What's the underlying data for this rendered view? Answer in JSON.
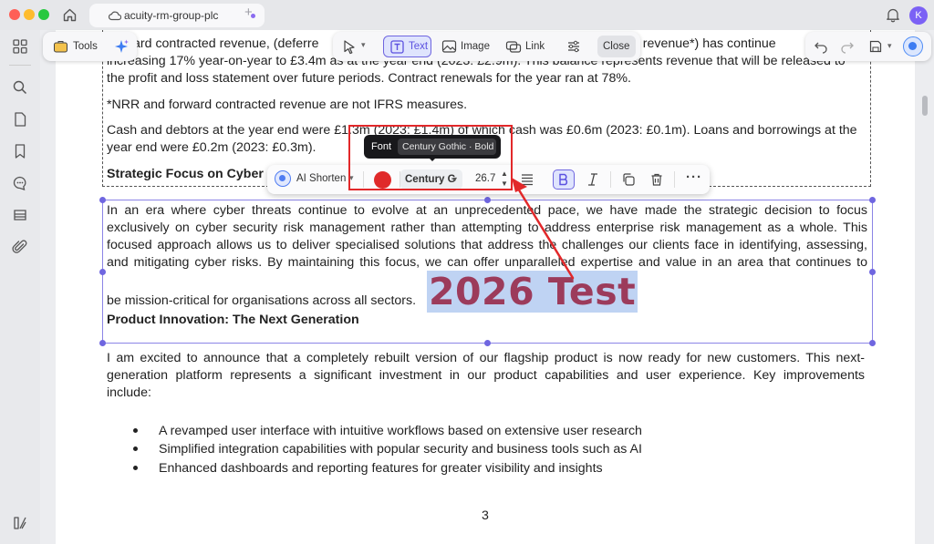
{
  "window": {
    "tab_title": "acuity-rm-group-plc",
    "new_tab": "+",
    "avatar_initial": "K"
  },
  "toolbar": {
    "tools_label": "Tools",
    "text_label": "Text",
    "image_label": "Image",
    "link_label": "Link",
    "close_label": "Close"
  },
  "float_bar": {
    "ai_label": "AI Shorten",
    "font_name": "Century G",
    "font_size": "26.7",
    "color": "#e02a2a"
  },
  "tooltip": {
    "label": "Font",
    "value": "Century Gothic · Bold"
  },
  "document": {
    "p1_line1_left": "ard contracted revenue, (deferre",
    "p1_line1_right": "cted revenue*) has continue",
    "p1_line2": "increasing 17% year-on-year to £3.4m as at the year end (2023: £2.9m). This balance represents revenue that will be released to",
    "p1_line3": "the profit and loss statement over future periods. Contract renewals for the year ran at 78%.",
    "p2": "*NRR and forward contracted revenue are not IFRS measures.",
    "p3_line1": "Cash and debtors at the year end were £1.3m (2023: £1.4m) of which cash was £0.6m (2023: £0.1m). Loans and borrowings at the",
    "p3_line2": "year end were £0.2m (2023: £0.3m).",
    "heading1": "Strategic Focus on Cyber Se",
    "p4_line1": "In an era where cyber threats continue to evolve at an unprecedented pace, we have made the strategic decision to focus",
    "p4_line2": "exclusively on cyber security risk management rather than attempting to address enterprise risk management as a whole. This",
    "p4_line3": "focused approach allows us to deliver specialised solutions that address the challenges our clients face in identifying, assessing,",
    "p4_line4": "and mitigating cyber risks. By maintaining this focus, we can offer unparalleled expertise and value in an area that continues to",
    "p4_line5": "be mission-critical for organisations across all sectors.",
    "inserted_text": "2026 Test",
    "heading2": "Product Innovation: The Next Generation",
    "p5_line1": "I am excited to announce that a completely rebuilt version of our flagship product is now ready for new customers. This next-",
    "p5_line2": "generation platform represents a significant investment in our product capabilities and user experience. Key improvements",
    "p5_line3": "include:",
    "bullets": [
      "A revamped user interface with intuitive workflows based on extensive user research",
      "Simplified integration capabilities with popular security and business tools such as AI",
      "Enhanced dashboards and reporting features for greater visibility and insights"
    ],
    "page_number": "3"
  },
  "colors": {
    "accent": "#6f66e0",
    "annotation": "#e2282a",
    "inserted_text": "#9c3b5b",
    "highlight": "#bfd3f3"
  }
}
